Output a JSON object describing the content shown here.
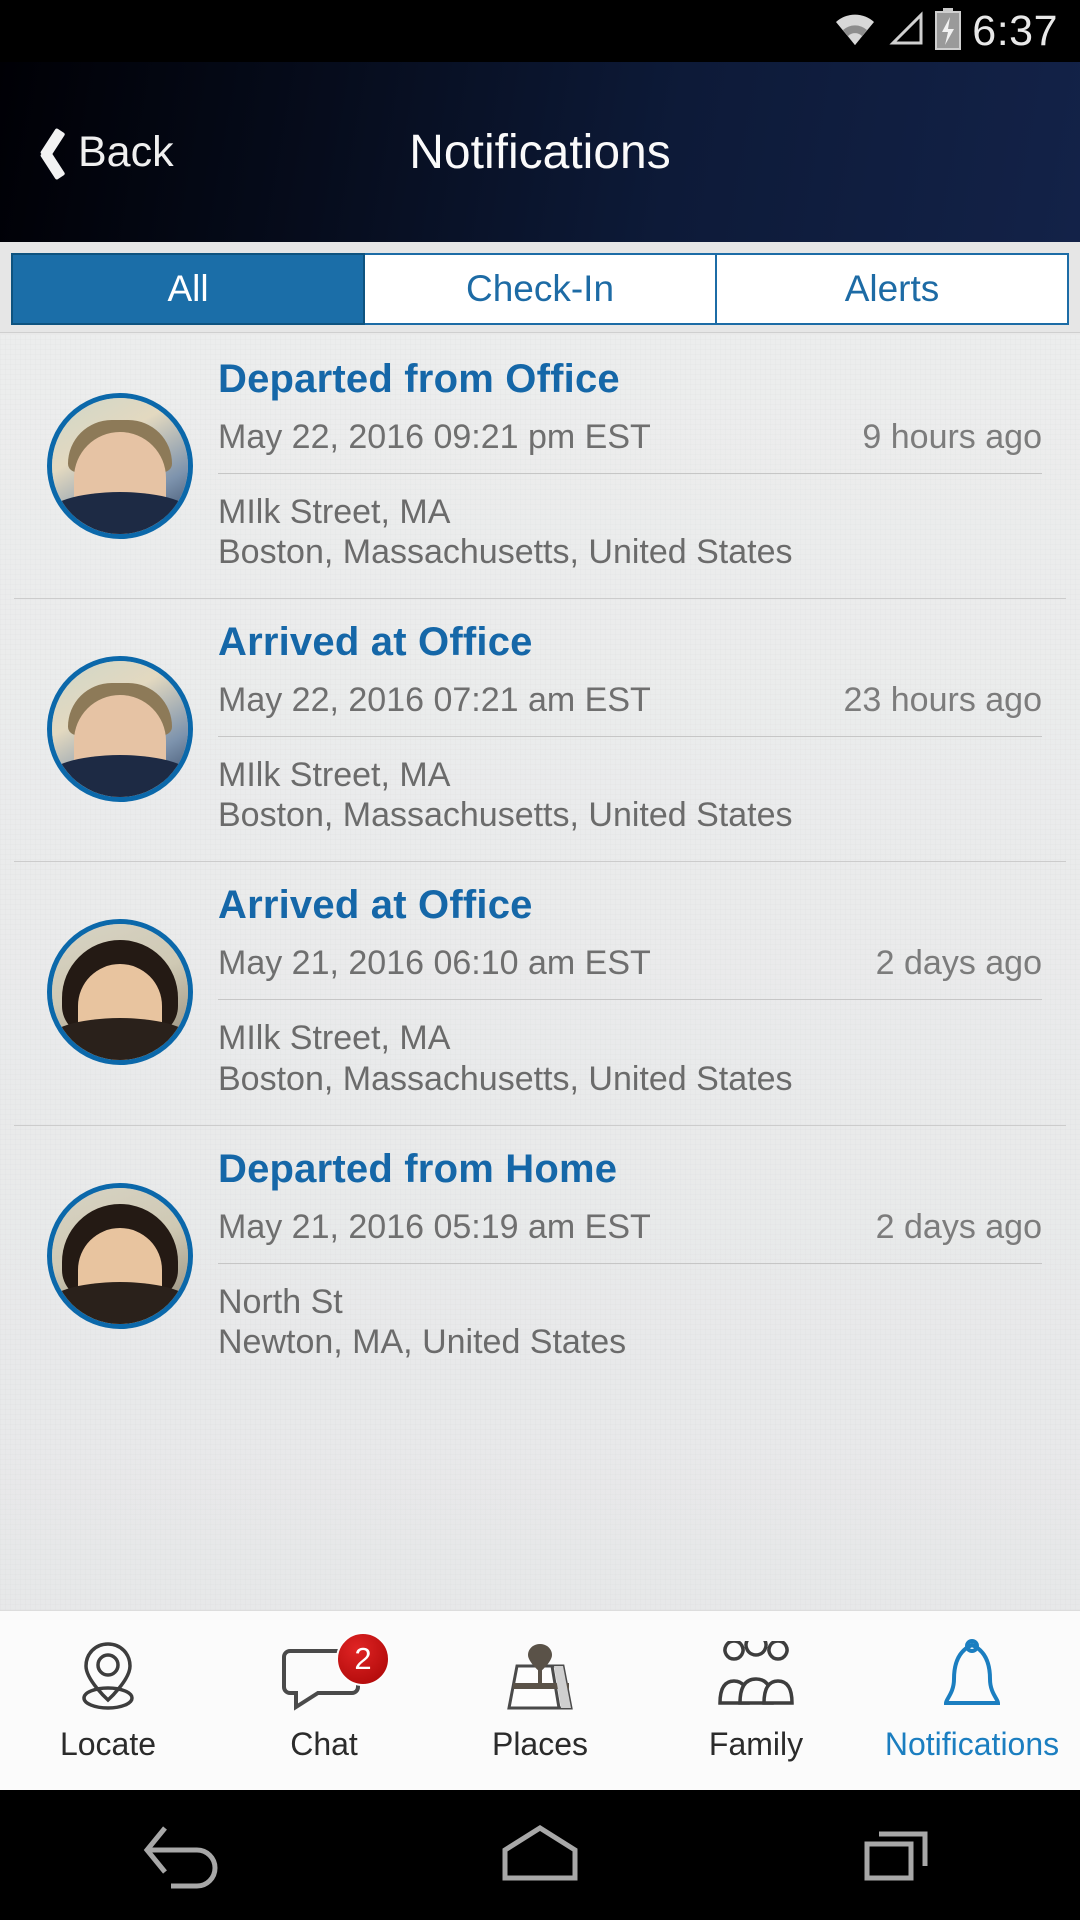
{
  "status_bar": {
    "time": "6:37",
    "icons": [
      "wifi-icon",
      "cell-signal-icon",
      "battery-charging-icon"
    ]
  },
  "header": {
    "back_label": "Back",
    "title": "Notifications",
    "back_icon": "chevron-left-icon"
  },
  "tabs": {
    "items": [
      {
        "label": "All",
        "active": true
      },
      {
        "label": "Check-In",
        "active": false
      },
      {
        "label": "Alerts",
        "active": false
      }
    ]
  },
  "notifications": [
    {
      "title": "Departed from Office",
      "date": "May 22, 2016 09:21 pm EST",
      "ago": "9 hours ago",
      "address_line1": "MIlk Street, MA",
      "address_line2": "Boston, Massachusetts, United States",
      "avatar": "avatar-male"
    },
    {
      "title": "Arrived at Office",
      "date": "May 22, 2016 07:21 am EST",
      "ago": "23 hours ago",
      "address_line1": "MIlk Street, MA",
      "address_line2": "Boston, Massachusetts, United States",
      "avatar": "avatar-male"
    },
    {
      "title": "Arrived at Office",
      "date": "May 21, 2016 06:10 am EST",
      "ago": "2 days ago",
      "address_line1": "MIlk Street, MA",
      "address_line2": "Boston, Massachusetts, United States",
      "avatar": "avatar-female"
    },
    {
      "title": "Departed from Home",
      "date": "May 21, 2016 05:19 am EST",
      "ago": "2 days ago",
      "address_line1": "North St",
      "address_line2": "Newton, MA, United States",
      "avatar": "avatar-female"
    }
  ],
  "bottom_nav": {
    "items": [
      {
        "label": "Locate",
        "icon": "map-pin-icon",
        "active": false,
        "badge": ""
      },
      {
        "label": "Chat",
        "icon": "chat-bubble-icon",
        "active": false,
        "badge": "2"
      },
      {
        "label": "Places",
        "icon": "map-places-icon",
        "active": false,
        "badge": ""
      },
      {
        "label": "Family",
        "icon": "people-group-icon",
        "active": false,
        "badge": ""
      },
      {
        "label": "Notifications",
        "icon": "bell-icon",
        "active": true,
        "badge": ""
      }
    ]
  },
  "android_nav": {
    "items": [
      {
        "icon": "back-arrow-icon"
      },
      {
        "icon": "home-icon"
      },
      {
        "icon": "recents-icon"
      }
    ]
  },
  "colors": {
    "accent_blue": "#1567a8",
    "tab_active_bg": "#1b6ea8",
    "badge_red": "#c01515",
    "header_dark": "#0d1a38"
  }
}
